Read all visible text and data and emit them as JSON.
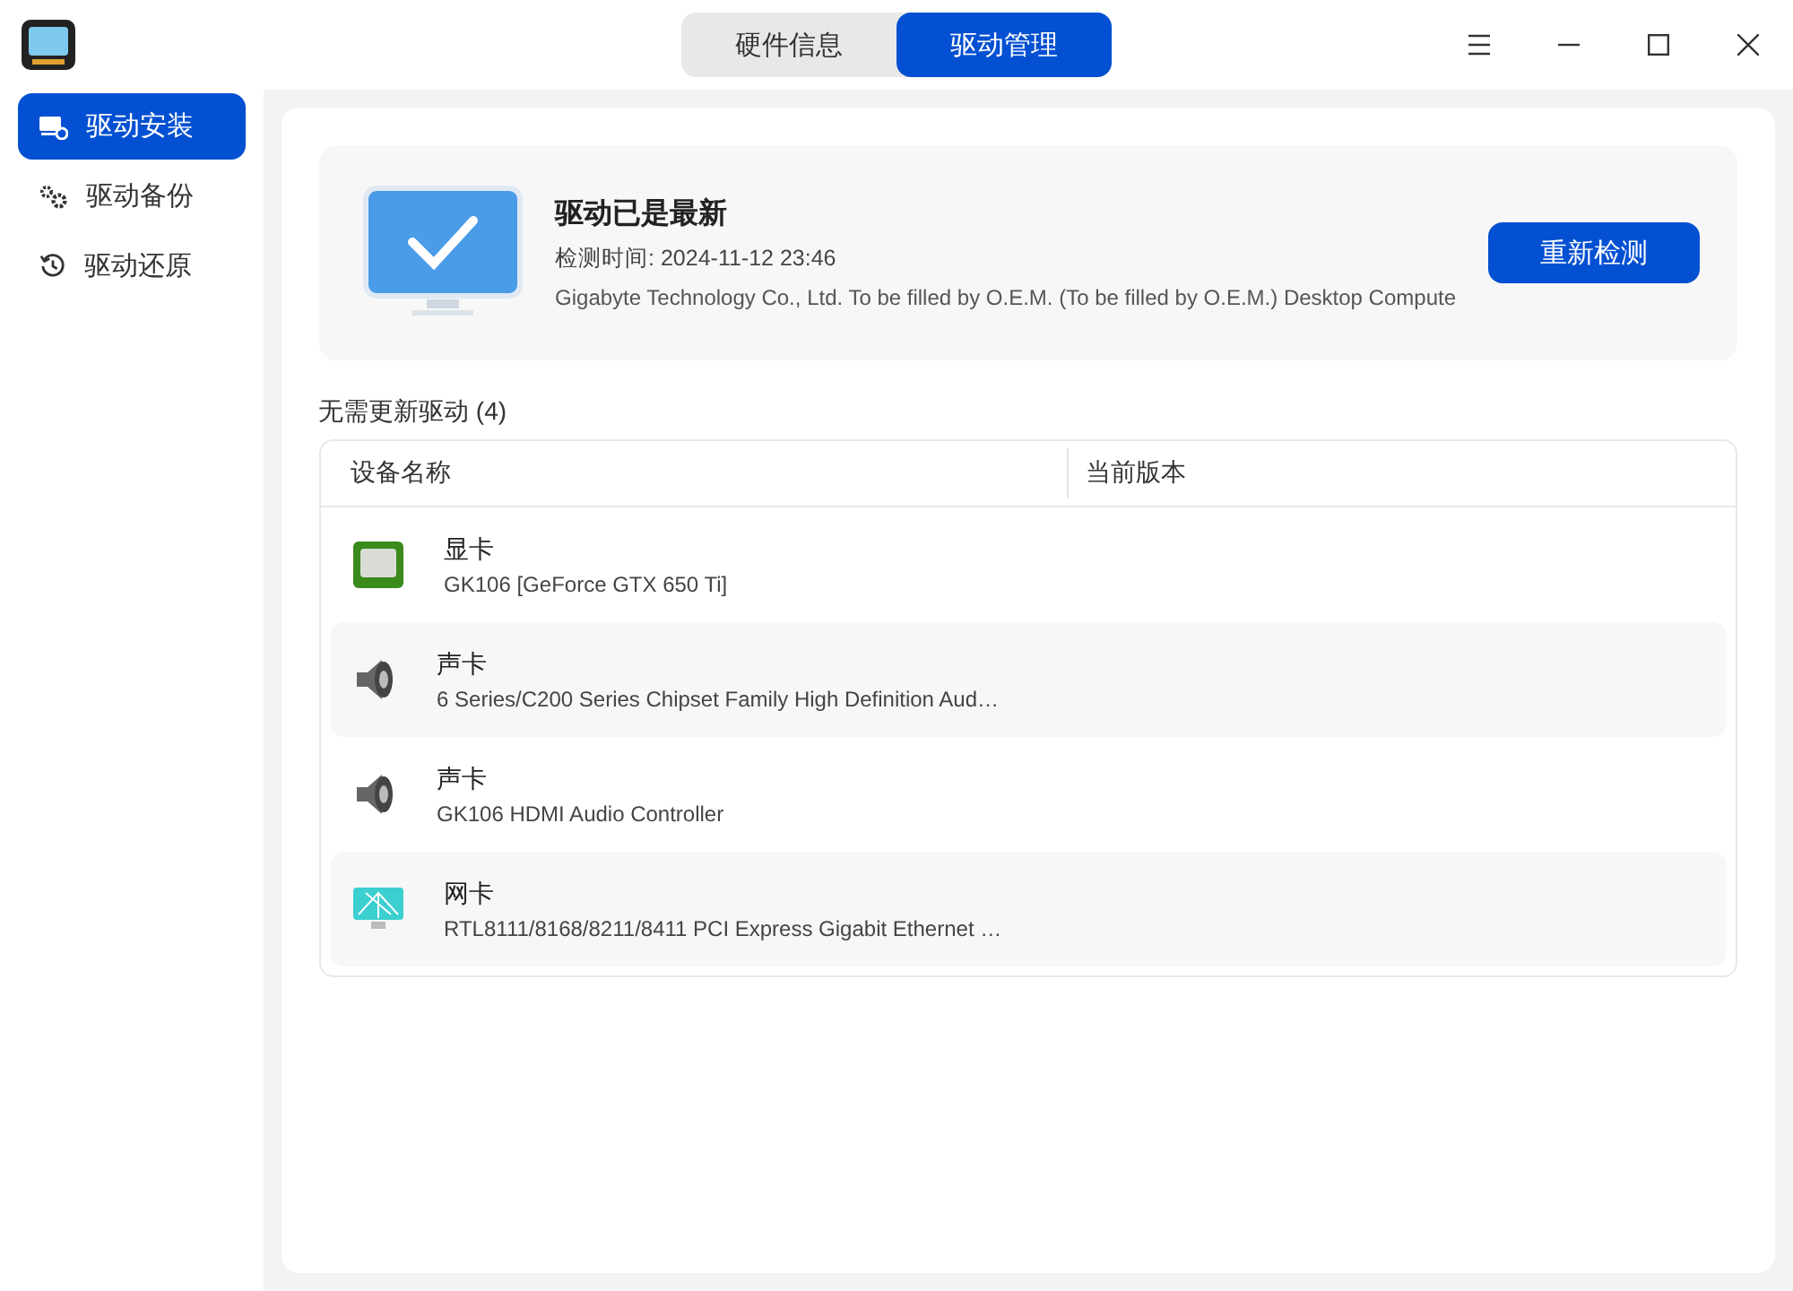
{
  "title_tabs": [
    {
      "label": "硬件信息",
      "selected": false
    },
    {
      "label": "驱动管理",
      "selected": true
    }
  ],
  "sidebar": {
    "items": [
      {
        "label": "驱动安装",
        "kind": "install",
        "selected": true
      },
      {
        "label": "驱动备份",
        "kind": "backup",
        "selected": false
      },
      {
        "label": "驱动还原",
        "kind": "restore",
        "selected": false
      }
    ]
  },
  "status_card": {
    "title": "驱动已是最新",
    "check_time": "检测时间: 2024-11-12 23:46",
    "system": "Gigabyte Technology Co., Ltd. To be filled by O.E.M. (To be filled by O.E.M.) Desktop Compute",
    "button": "重新检测"
  },
  "section_title": "无需更新驱动 (4)",
  "table": {
    "columns": [
      "设备名称",
      "当前版本"
    ],
    "rows": [
      {
        "kind": "gpu",
        "name": "显卡",
        "model": "GK106 [GeForce GTX 650 Ti]"
      },
      {
        "kind": "audio",
        "name": "声卡",
        "model": "6 Series/C200 Series Chipset Family High Definition Aud…"
      },
      {
        "kind": "audio",
        "name": "声卡",
        "model": "GK106 HDMI Audio Controller"
      },
      {
        "kind": "network",
        "name": "网卡",
        "model": "RTL8111/8168/8211/8411 PCI Express Gigabit Ethernet …"
      }
    ]
  }
}
